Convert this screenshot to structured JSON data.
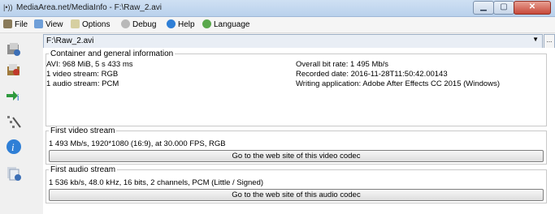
{
  "window": {
    "title": "MediaArea.net/MediaInfo - F:\\Raw_2.avi",
    "controls": {
      "minimize": "▁",
      "maximize": "▢",
      "close": "✕"
    }
  },
  "menu": {
    "file": "File",
    "view": "View",
    "options": "Options",
    "debug": "Debug",
    "help": "Help",
    "language": "Language"
  },
  "file_selector": {
    "value": "F:\\Raw_2.avi",
    "more": "..."
  },
  "container": {
    "title": "Container and general information",
    "left": [
      "AVI: 968 MiB, 5 s 433 ms",
      "1 video stream: RGB",
      "1 audio stream: PCM"
    ],
    "right": [
      "Overall bit rate: 1 495 Mb/s",
      "Recorded date: 2016-11-28T11:50:42.00143",
      "Writing application: Adobe After Effects CC 2015 (Windows)"
    ]
  },
  "video": {
    "title": "First video stream",
    "info": "1 493 Mb/s, 1920*1080 (16:9), at 30.000 FPS, RGB",
    "link": "Go to the web site of this video codec"
  },
  "audio": {
    "title": "First audio stream",
    "info": "1 536 kb/s, 48.0 kHz, 16 bits, 2 channels, PCM (Little / Signed)",
    "link": "Go to the web site of this audio codec"
  },
  "colors": {
    "titlebar": "#c4d8ef",
    "close": "#c7493a",
    "accent": "#1f6fc5"
  }
}
